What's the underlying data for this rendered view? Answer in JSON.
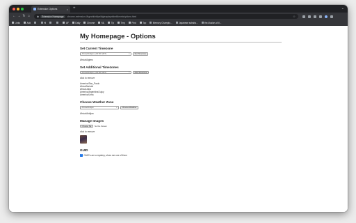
{
  "browser": {
    "tab_title": "Extension Options",
    "tab_close": "×",
    "new_tab": "+",
    "tabbar_menu": "⌄",
    "nav": {
      "back": "←",
      "forward": "→",
      "reload": "↻",
      "home": "⌂"
    },
    "omnibox_chip": "Extension Homepage",
    "url": "chrome-extension://kgeahkhkfpniklgleaplapnfkmklkmnb/options.html",
    "star": "☆",
    "bookmarks": [
      {
        "label": "Links",
        "kind": "folder"
      },
      {
        "label": "Add",
        "kind": "folder"
      },
      {
        "label": "",
        "kind": "site"
      },
      {
        "label": "HI",
        "kind": "site"
      },
      {
        "label": "",
        "kind": "site"
      },
      {
        "label": "",
        "kind": "site"
      },
      {
        "label": "AF",
        "kind": "folder"
      },
      {
        "label": "Daily",
        "kind": "folder"
      },
      {
        "label": "Chrome",
        "kind": "folder"
      },
      {
        "label": "ML",
        "kind": "folder"
      },
      {
        "label": "Tip",
        "kind": "folder"
      },
      {
        "label": "Tmp",
        "kind": "folder"
      },
      {
        "label": "Find",
        "kind": "folder"
      },
      {
        "label": "Top",
        "kind": "folder"
      },
      {
        "label": "Memory Champio...",
        "kind": "site"
      },
      {
        "label": "Japanese subsita...",
        "kind": "site"
      },
      {
        "label": "the-illusion-of-ti...",
        "kind": "site"
      }
    ]
  },
  "page": {
    "title": "My Homepage - Options",
    "current_tz": {
      "heading": "Set Current Timezone",
      "select_value": "Africa/Abidjan (+00:00 GMT)",
      "button": "Set Timezone",
      "value": "Africa/Algiers"
    },
    "additional_tz": {
      "heading": "Set Additional Timezones",
      "select_value": "Africa/Abidjan (+00:00 GMT)",
      "button": "Add Timezone",
      "hint": "click to remove",
      "items": [
        "America/Sao_Paulo",
        "Africa/Nairobi",
        "Africa/Juba",
        "America/Argentina/Jujuy",
        "America/Lima"
      ]
    },
    "weather": {
      "heading": "Choose Weather Zone",
      "select_value": "Africa/Abidjan",
      "button": "Choose Weather",
      "value": "Africa/Abidjan"
    },
    "images": {
      "heading": "Manage Images",
      "file_button": "Choose file",
      "file_status": "No file chosen",
      "hint": "click to remove"
    },
    "guid": {
      "heading": "GUID",
      "checkbox_label": "GUID's are a mystery, show me one of them",
      "checked": true
    }
  }
}
